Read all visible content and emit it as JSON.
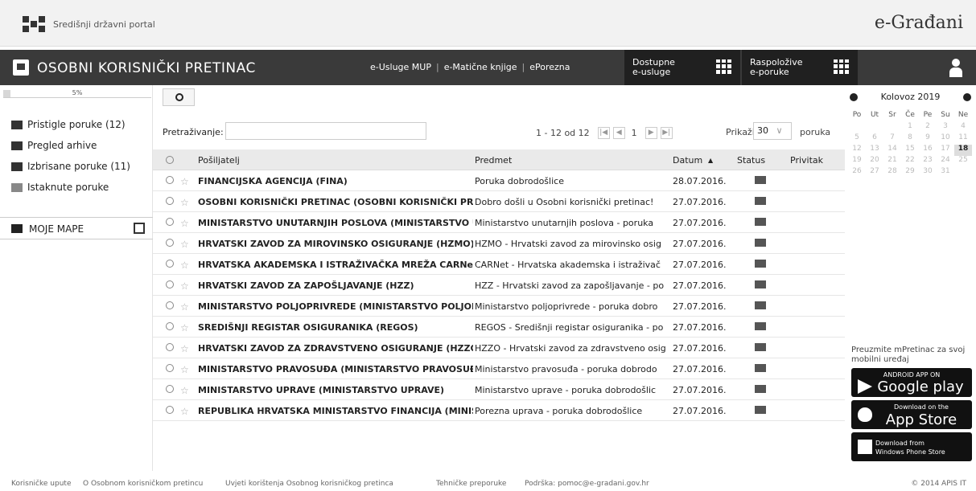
{
  "portal": {
    "name": "Središnji državni portal",
    "brand": "e-Građani"
  },
  "header": {
    "title": "OSOBNI KORISNIČKI PRETINAC",
    "links": [
      "e-Usluge MUP",
      "e-Matične knjige",
      "ePorezna"
    ],
    "btn_usluge": [
      "Dostupne",
      "e-usluge"
    ],
    "btn_poruke": [
      "Raspoložive",
      "e-poruke"
    ]
  },
  "sidebar": {
    "storage_percent": "5%",
    "storage_fraction": 0.05,
    "items": [
      {
        "label": "Pristigle poruke (12)"
      },
      {
        "label": "Pregled arhive"
      },
      {
        "label": "Izbrisane poruke (11)"
      },
      {
        "label": "Istaknute poruke"
      }
    ],
    "folders_label": "MOJE MAPE"
  },
  "toolbar": {
    "search_label": "Pretraživanje:",
    "search_value": "",
    "pager_text": "1 - 12 od 12",
    "current_page": "1",
    "show_label": "Prikaži",
    "per_page": "30",
    "per_page_suffix": "poruka"
  },
  "table": {
    "headers": {
      "sender": "Pošiljatelj",
      "subject": "Predmet",
      "date": "Datum",
      "status": "Status",
      "attachment": "Privitak"
    },
    "rows": [
      {
        "sender": "FINANCIJSKA AGENCIJA (FINA)",
        "subject": "Poruka dobrodošlice",
        "date": "28.07.2016."
      },
      {
        "sender": "OSOBNI KORISNIČKI PRETINAC (OSOBNI KORISNIČKI PRE",
        "subject": "Dobro došli u Osobni korisnički pretinac!",
        "date": "27.07.2016."
      },
      {
        "sender": "MINISTARSTVO UNUTARNJIH POSLOVA (MINISTARSTVO U",
        "subject": "Ministarstvo unutarnjih poslova - poruka",
        "date": "27.07.2016."
      },
      {
        "sender": "HRVATSKI ZAVOD ZA MIROVINSKO OSIGURANJE (HZMO)",
        "subject": "HZMO - Hrvatski zavod za mirovinsko osig",
        "date": "27.07.2016."
      },
      {
        "sender": "HRVATSKA AKADEMSKA I ISTRAŽIVAČKA MREŽA CARNet (",
        "subject": "CARNet - Hrvatska akademska i istraživač",
        "date": "27.07.2016."
      },
      {
        "sender": "HRVATSKI ZAVOD ZA ZAPOŠLJAVANJE (HZZ)",
        "subject": "HZZ - Hrvatski zavod za zapošljavanje - po",
        "date": "27.07.2016."
      },
      {
        "sender": "MINISTARSTVO POLJOPRIVREDE (MINISTARSTVO POLJOPI",
        "subject": "Ministarstvo poljoprivrede - poruka dobro",
        "date": "27.07.2016."
      },
      {
        "sender": "SREDIŠNJI REGISTAR OSIGURANIKA (REGOS)",
        "subject": "REGOS - Središnji registar osiguranika - po",
        "date": "27.07.2016."
      },
      {
        "sender": "HRVATSKI ZAVOD ZA ZDRAVSTVENO OSIGURANJE (HZZO)",
        "subject": "HZZO - Hrvatski zavod za zdravstveno osig",
        "date": "27.07.2016."
      },
      {
        "sender": "MINISTARSTVO PRAVOSUĐA (MINISTARSTVO PRAVOSUĐA",
        "subject": "Ministarstvo pravosuđa - poruka dobrodo",
        "date": "27.07.2016."
      },
      {
        "sender": "MINISTARSTVO UPRAVE (MINISTARSTVO UPRAVE)",
        "subject": "Ministarstvo uprave - poruka dobrodošlic",
        "date": "27.07.2016."
      },
      {
        "sender": "REPUBLIKA HRVATSKA MINISTARSTVO FINANCIJA (MINIST",
        "subject": "Porezna uprava - poruka dobrodošlice",
        "date": "27.07.2016."
      }
    ]
  },
  "calendar": {
    "title": "Kolovoz 2019",
    "weekdays": [
      "Po",
      "Ut",
      "Sr",
      "Če",
      "Pe",
      "Su",
      "Ne"
    ],
    "weeks": [
      [
        "",
        "",
        "",
        "1",
        "2",
        "3",
        "4"
      ],
      [
        "5",
        "6",
        "7",
        "8",
        "9",
        "10",
        "11"
      ],
      [
        "12",
        "13",
        "14",
        "15",
        "16",
        "17",
        "18"
      ],
      [
        "19",
        "20",
        "21",
        "22",
        "23",
        "24",
        "25"
      ],
      [
        "26",
        "27",
        "28",
        "29",
        "30",
        "31",
        ""
      ]
    ],
    "today": "18"
  },
  "mobile": {
    "text": "Preuzmite mPretinac za svoj mobilni uređaj",
    "google_small": "ANDROID APP ON",
    "google_big": "Google play",
    "apple_small": "Download on the",
    "apple_big": "App Store",
    "windows_small": "Download from",
    "windows_big": "Windows Phone Store"
  },
  "footer": {
    "links": [
      "Korisničke upute",
      "O Osobnom korisničkom pretincu",
      "Uvjeti korištenja Osobnog korisničkog pretinca",
      "Tehničke preporuke",
      "Podrška: pomoc@e-gradani.gov.hr"
    ],
    "copyright": "© 2014 APIS IT"
  }
}
